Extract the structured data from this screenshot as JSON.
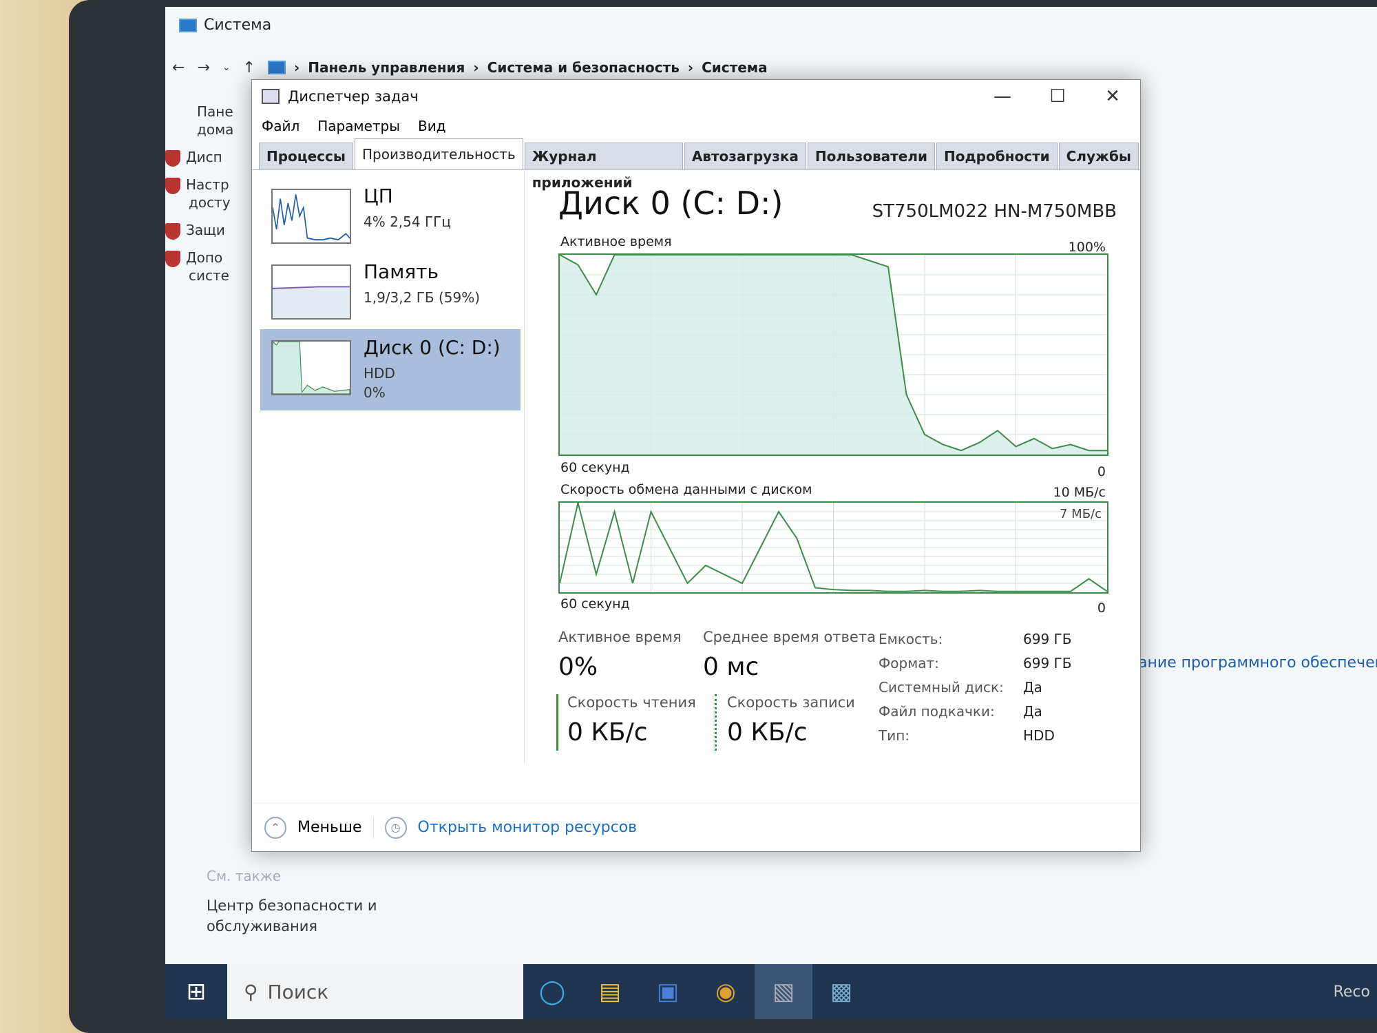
{
  "control_panel": {
    "window_title": "Система",
    "breadcrumb": [
      "Панель управления",
      "Система и безопасность",
      "Система"
    ],
    "sidebar_items": [
      "Пане",
      "дома",
      "Дисп",
      "Настр",
      "досту",
      "Защи",
      "Допо",
      "систе"
    ],
    "see_also": "См. также",
    "security_link": "Центр безопасности и обслуживания",
    "right_text": "вание программного обеспечени"
  },
  "task_manager": {
    "title": "Диспетчер задач",
    "menu": [
      "Файл",
      "Параметры",
      "Вид"
    ],
    "tabs": [
      "Процессы",
      "Производительность",
      "Журнал приложений",
      "Автозагрузка",
      "Пользователи",
      "Подробности",
      "Службы"
    ],
    "active_tab": "Производительность",
    "resources": [
      {
        "name": "ЦП",
        "sub1": "4% 2,54 ГГц",
        "sub2": ""
      },
      {
        "name": "Память",
        "sub1": "1,9/3,2 ГБ (59%)",
        "sub2": ""
      },
      {
        "name": "Диск 0 (C: D:)",
        "sub1": "HDD",
        "sub2": "0%"
      }
    ],
    "disk": {
      "title": "Диск 0 (C: D:)",
      "model": "ST750LM022 HN-M750MBB",
      "chart1_label": "Активное время",
      "chart1_max": "100%",
      "chart1_xleft": "60 секунд",
      "chart1_xright": "0",
      "chart2_label": "Скорость обмена данными с диском",
      "chart2_max": "10 МБ/с",
      "chart2_mid": "7 МБ/с",
      "chart2_xleft": "60 секунд",
      "chart2_xright": "0",
      "stats": {
        "active_time_label": "Активное время",
        "active_time_value": "0%",
        "response_label": "Среднее время ответа",
        "response_value": "0 мс",
        "read_label": "Скорость чтения",
        "read_value": "0 КБ/с",
        "write_label": "Скорость записи",
        "write_value": "0 КБ/с"
      },
      "properties": [
        {
          "key": "Емкость:",
          "value": "699 ГБ"
        },
        {
          "key": "Формат:",
          "value": "699 ГБ"
        },
        {
          "key": "Системный диск:",
          "value": "Да"
        },
        {
          "key": "Файл подкачки:",
          "value": "Да"
        },
        {
          "key": "Тип:",
          "value": "HDD"
        }
      ]
    },
    "footer": {
      "less": "Меньше",
      "monitor": "Открыть монитор ресурсов"
    }
  },
  "taskbar": {
    "search_placeholder": "Поиск",
    "tray_text": "Reco"
  },
  "colors": {
    "chart_line": "#3d8b4a",
    "chart_fill": "#d2ece8",
    "selected": "#a9bedc",
    "taskbar": "#1f3550"
  },
  "chart_data": [
    {
      "type": "area",
      "ylabel": "Активное время",
      "ylim": [
        0,
        100
      ],
      "x": [
        60,
        58,
        56,
        54,
        52,
        50,
        48,
        46,
        44,
        42,
        40,
        38,
        36,
        34,
        32,
        30,
        28,
        26,
        24,
        22,
        20,
        18,
        16,
        14,
        12,
        10,
        8,
        6,
        4,
        2,
        0
      ],
      "values": [
        100,
        95,
        80,
        100,
        100,
        100,
        100,
        100,
        100,
        100,
        100,
        100,
        100,
        100,
        100,
        100,
        100,
        97,
        94,
        30,
        10,
        5,
        2,
        6,
        12,
        4,
        8,
        3,
        5,
        2,
        2
      ]
    },
    {
      "type": "line",
      "ylabel": "Скорость обмена данными с диском",
      "ylim": [
        0,
        10
      ],
      "x": [
        60,
        58,
        56,
        54,
        52,
        50,
        48,
        46,
        44,
        42,
        40,
        38,
        36,
        34,
        32,
        30,
        28,
        26,
        24,
        22,
        20,
        18,
        16,
        14,
        12,
        10,
        8,
        6,
        4,
        2,
        0
      ],
      "values": [
        1,
        10,
        2,
        9,
        1,
        9,
        5,
        1,
        3,
        2,
        1,
        5,
        9,
        6,
        0.5,
        0.3,
        0.2,
        0.2,
        0.1,
        0.1,
        0.2,
        0.1,
        0.1,
        0.2,
        0.1,
        0.1,
        0.1,
        0.1,
        0.1,
        1.5,
        0.1
      ]
    }
  ]
}
